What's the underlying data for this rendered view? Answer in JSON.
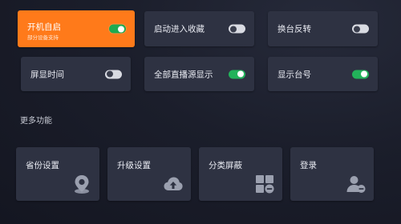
{
  "settings": [
    {
      "label": "开机自启",
      "sublabel": "部分设备支持",
      "enabled": true,
      "selected": true
    },
    {
      "label": "启动进入收藏",
      "enabled": false
    },
    {
      "label": "换台反转",
      "enabled": false
    },
    {
      "label": "屏显时间",
      "enabled": false
    },
    {
      "label": "全部直播源显示",
      "enabled": true
    },
    {
      "label": "显示台号",
      "enabled": true
    }
  ],
  "more": {
    "title": "更多功能",
    "items": [
      {
        "label": "省份设置",
        "icon": "location-pin-icon"
      },
      {
        "label": "升级设置",
        "icon": "cloud-upload-icon"
      },
      {
        "label": "分类屏蔽",
        "icon": "category-grid-icon"
      },
      {
        "label": "登录",
        "icon": "user-login-icon"
      }
    ]
  },
  "colors": {
    "accent": "#ff7a1a",
    "toggle_on": "#22b25a",
    "tile": "#2e3242",
    "background": "#1b1e2b"
  }
}
